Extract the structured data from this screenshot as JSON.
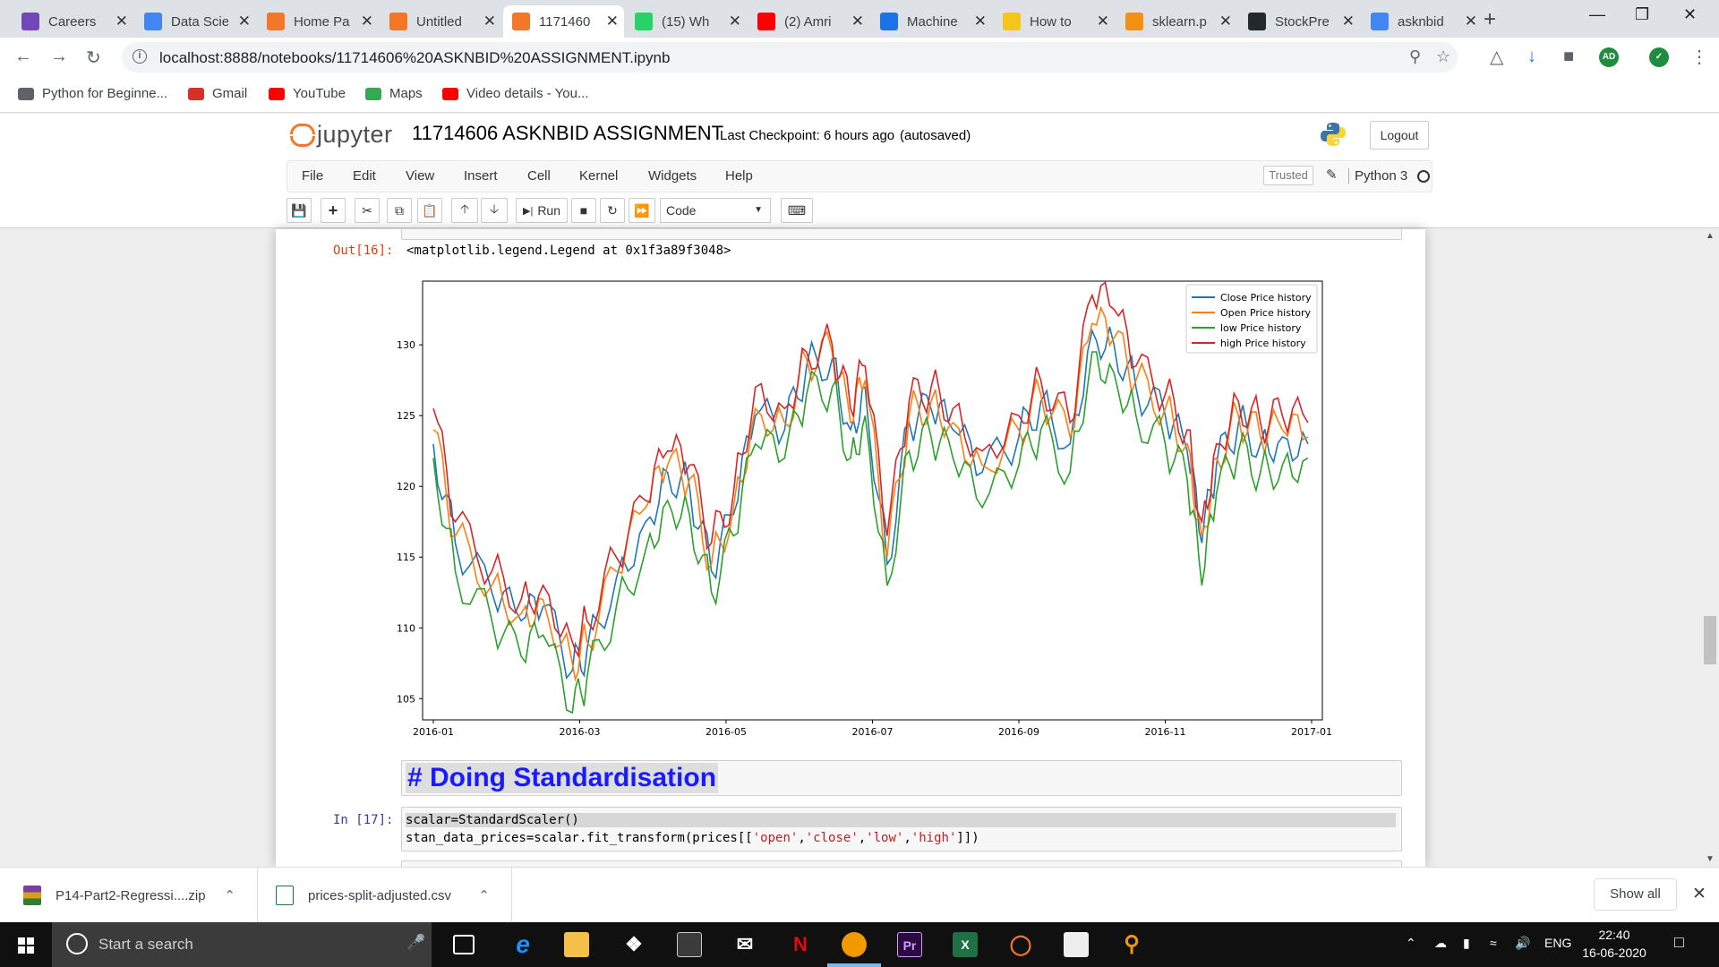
{
  "browser": {
    "tabs": [
      {
        "title": "Careers",
        "icon": "forms-icon",
        "color": "#7248b9"
      },
      {
        "title": "Data Scie",
        "icon": "docs-icon",
        "color": "#4285f4"
      },
      {
        "title": "Home Pa",
        "icon": "jupyter-icon",
        "color": "#f37726"
      },
      {
        "title": "Untitled",
        "icon": "notebook-icon",
        "color": "#f37726"
      },
      {
        "title": "1171460",
        "icon": "notebook-icon",
        "color": "#f37726"
      },
      {
        "title": "(15) Wh",
        "icon": "whatsapp-icon",
        "color": "#25d366"
      },
      {
        "title": "(2) Amri",
        "icon": "youtube-icon",
        "color": "#ff0000"
      },
      {
        "title": "Machine",
        "icon": "s-icon",
        "color": "#1a73e8"
      },
      {
        "title": "How to",
        "icon": "k-icon",
        "color": "#f5c518"
      },
      {
        "title": "sklearn.p",
        "icon": "chart-icon",
        "color": "#f29111"
      },
      {
        "title": "StockPre",
        "icon": "github-icon",
        "color": "#24292e"
      },
      {
        "title": "asknbid",
        "icon": "google-icon",
        "color": "#4285f4"
      }
    ],
    "active_tab": 4,
    "url": "localhost:8888/notebooks/11714606%20ASKNBID%20ASSIGNMENT.ipynb",
    "profile_initials": "AD",
    "bookmarks": [
      {
        "label": "Python for Beginne...",
        "icon": "globe-icon",
        "color": "#5f6368"
      },
      {
        "label": "Gmail",
        "icon": "gmail-icon",
        "color": "#d93025"
      },
      {
        "label": "YouTube",
        "icon": "youtube-icon",
        "color": "#ff0000"
      },
      {
        "label": "Maps",
        "icon": "maps-icon",
        "color": "#34a853"
      },
      {
        "label": "Video details - You...",
        "icon": "youtube-icon",
        "color": "#ff0000"
      }
    ]
  },
  "jupyter": {
    "logo_text": "jupyter",
    "notebook_name": "11714606 ASKNBID ASSIGNMENT",
    "checkpoint": "Last Checkpoint: 6 hours ago",
    "autosave": "(autosaved)",
    "logout_label": "Logout",
    "menu": [
      "File",
      "Edit",
      "View",
      "Insert",
      "Cell",
      "Kernel",
      "Widgets",
      "Help"
    ],
    "trusted_label": "Trusted",
    "kernel_name": "Python 3",
    "run_label": "Run",
    "cell_type": "Code"
  },
  "cells": {
    "out_prompt": "Out[16]:",
    "out_text": "<matplotlib.legend.Legend at 0x1f3a89f3048>",
    "markdown_heading": "# Doing Standardisation",
    "in_prompt": "In [17]:",
    "code_line1": "scalar=StandardScaler()",
    "code_line2_prefix": "stan_data_prices=scalar.fit_transform(prices[[",
    "code_str1": "'open'",
    "code_str2": "'close'",
    "code_str3": "'low'",
    "code_str4": "'high'",
    "code_line2_suffix": "]])",
    "comma": ","
  },
  "chart_data": {
    "type": "line",
    "x_ticks": [
      "2016-01",
      "2016-03",
      "2016-05",
      "2016-07",
      "2016-09",
      "2016-11",
      "2017-01"
    ],
    "y_ticks": [
      105,
      110,
      115,
      120,
      125,
      130
    ],
    "xlim": [
      "2016-01-01",
      "2017-01-01"
    ],
    "ylim": [
      103.5,
      134.5
    ],
    "legend_position": "upper right",
    "grid": false,
    "keypoints_months": [
      0.0,
      0.3,
      0.8,
      1.2,
      1.5,
      1.9,
      2.1,
      2.5,
      2.9,
      3.2,
      3.5,
      3.8,
      4.1,
      4.4,
      4.8,
      5.1,
      5.45,
      5.7,
      5.9,
      6.2,
      6.5,
      6.8,
      7.1,
      7.5,
      8.0,
      8.3,
      8.7,
      9.0,
      9.3,
      9.6,
      10.0,
      10.3,
      10.5,
      10.7,
      11.0,
      11.3,
      11.6,
      11.95
    ],
    "series": [
      {
        "name": "Close Price history",
        "color": "#1f77b4",
        "values": [
          123.0,
          116.0,
          112.5,
          110.5,
          111.5,
          107.0,
          108.5,
          113.5,
          117.5,
          121.0,
          120.0,
          114.0,
          118.0,
          125.0,
          124.0,
          128.5,
          129.0,
          124.0,
          127.0,
          114.5,
          124.5,
          125.5,
          124.0,
          121.0,
          123.5,
          126.0,
          123.0,
          131.0,
          130.0,
          127.0,
          125.0,
          122.5,
          116.0,
          121.5,
          124.5,
          123.0,
          123.5,
          123.0
        ]
      },
      {
        "name": "Open Price history",
        "color": "#ff7f0e",
        "values": [
          124.0,
          116.5,
          113.0,
          111.0,
          112.0,
          107.5,
          109.0,
          114.0,
          118.5,
          121.5,
          120.5,
          114.5,
          118.5,
          125.5,
          124.5,
          129.0,
          129.5,
          124.5,
          127.5,
          115.0,
          125.0,
          126.0,
          124.5,
          121.5,
          124.0,
          126.5,
          123.5,
          131.5,
          130.5,
          127.5,
          125.5,
          123.0,
          116.5,
          122.0,
          125.0,
          123.5,
          124.0,
          123.5
        ]
      },
      {
        "name": "low Price history",
        "color": "#2ca02c",
        "values": [
          122.0,
          114.0,
          110.5,
          108.0,
          109.5,
          104.0,
          106.5,
          111.5,
          115.5,
          119.0,
          118.0,
          112.5,
          116.5,
          123.0,
          122.0,
          126.5,
          127.0,
          122.0,
          125.0,
          113.0,
          122.5,
          123.5,
          122.0,
          118.5,
          121.5,
          124.0,
          121.0,
          129.5,
          128.0,
          125.0,
          123.0,
          120.5,
          113.0,
          119.5,
          122.5,
          121.0,
          121.5,
          122.0
        ]
      },
      {
        "name": "high Price history",
        "color": "#d62728",
        "values": [
          125.5,
          117.5,
          114.0,
          112.0,
          113.0,
          109.0,
          110.5,
          115.0,
          119.0,
          122.5,
          121.5,
          116.0,
          119.5,
          127.0,
          125.5,
          129.5,
          130.0,
          125.5,
          128.5,
          116.5,
          126.0,
          127.0,
          125.5,
          122.5,
          125.0,
          127.5,
          124.5,
          133.5,
          132.5,
          128.5,
          126.5,
          124.0,
          117.5,
          123.0,
          126.0,
          124.5,
          125.0,
          124.5
        ]
      }
    ]
  },
  "downloads": [
    {
      "file": "P14-Part2-Regressi....zip",
      "icon": "zip-icon"
    },
    {
      "file": "prices-split-adjusted.csv",
      "icon": "excel-icon"
    }
  ],
  "show_all_label": "Show all",
  "taskbar": {
    "search_placeholder": "Start a search",
    "language": "ENG",
    "time": "22:40",
    "date": "16-06-2020"
  }
}
